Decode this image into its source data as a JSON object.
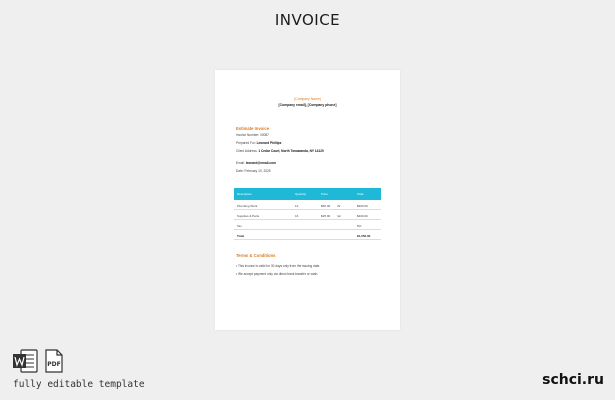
{
  "heading": "INVOICE",
  "invoice": {
    "company_name": "[Company Name]",
    "contact_line": "[Company email], [Company phone]",
    "estimate_title": "Estimate Invoice",
    "lines": [
      {
        "label": "Invoice Number: ",
        "value": "00087"
      },
      {
        "label": "Prepared For: ",
        "value": "Leonard Phillips"
      },
      {
        "label": "Client Address: ",
        "value": "1 Cedar Court, North Tonawanda, NY 14120"
      },
      {
        "label": "Email: ",
        "value": "leonard@email.com"
      },
      {
        "label": "Date: ",
        "value": "February 10, 2025"
      }
    ],
    "table": {
      "headers": [
        "Description",
        "Quantity",
        "Price",
        "",
        "Total"
      ],
      "rows": [
        {
          "description": "Plumbing Work",
          "qty": "12",
          "price": "$50.00",
          "unit": "/hr",
          "total": "$600.00"
        },
        {
          "description": "Supplies & Parts",
          "qty": "16",
          "price": "$25.00",
          "unit": "/pc",
          "total": "$400.00"
        },
        {
          "description": "Tax",
          "qty": "",
          "price": "",
          "unit": "",
          "total": "5%"
        }
      ],
      "total_label": "Total",
      "total_value": "$1,050.00"
    },
    "terms_title": "Terms & Conditions",
    "terms": [
      "• This invoice is valid for 30 days only from the issuing date.",
      "• We accept payment only via direct bank transfer or cash."
    ]
  },
  "icons": {
    "word": "word-file-icon",
    "pdf": "pdf-file-icon",
    "pdf_label": "PDF"
  },
  "footer": {
    "caption": "fully editable template",
    "site": "schci.ru"
  }
}
